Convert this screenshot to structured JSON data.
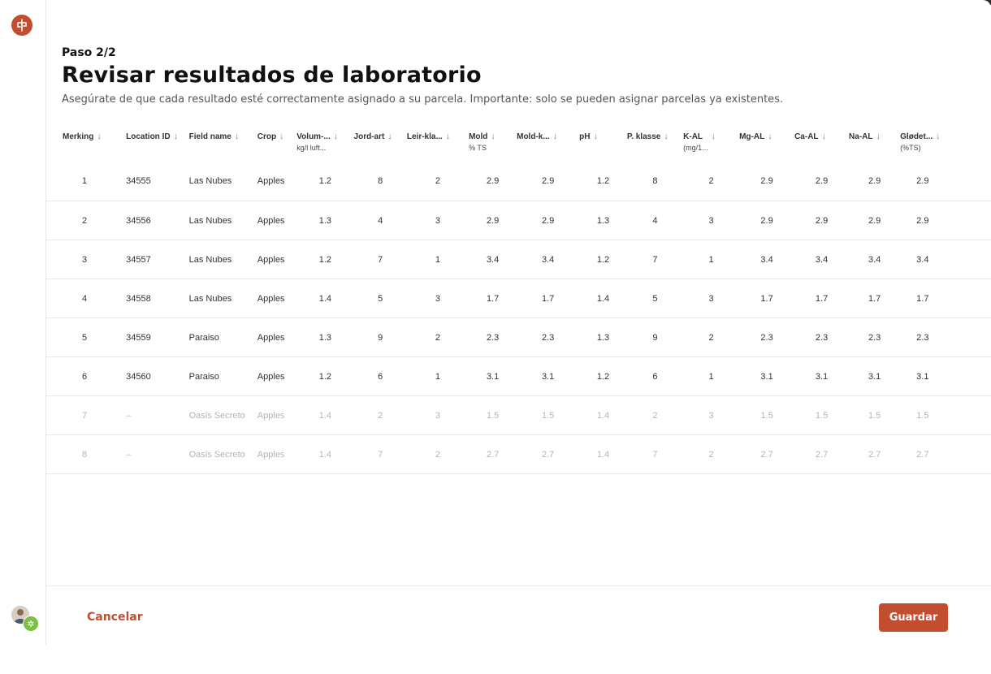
{
  "header": {
    "step": "Paso 2/2",
    "title": "Revisar resultados de laboratorio",
    "subtitle": "Asegúrate de que cada resultado esté correctamente asignado a su parcela. Importante: solo se pueden asignar parcelas ya existentes."
  },
  "columns": [
    {
      "label": "Merking",
      "sub": ""
    },
    {
      "label": "Location ID",
      "sub": ""
    },
    {
      "label": "Field name",
      "sub": ""
    },
    {
      "label": "Crop",
      "sub": ""
    },
    {
      "label": "Volum-...",
      "sub": "kg/l luft..."
    },
    {
      "label": "Jord-art",
      "sub": ""
    },
    {
      "label": "Leir-kla...",
      "sub": ""
    },
    {
      "label": "Mold",
      "sub": "% TS"
    },
    {
      "label": "Mold-k...",
      "sub": ""
    },
    {
      "label": "pH",
      "sub": ""
    },
    {
      "label": "P. klasse",
      "sub": ""
    },
    {
      "label": "K-AL",
      "sub": "(mg/1..."
    },
    {
      "label": "Mg-AL",
      "sub": ""
    },
    {
      "label": "Ca-AL",
      "sub": ""
    },
    {
      "label": "Na-AL",
      "sub": ""
    },
    {
      "label": "Glødet...",
      "sub": "(%TS)"
    }
  ],
  "rows": [
    [
      "1",
      "34555",
      "Las Nubes",
      "Apples",
      "1.2",
      "8",
      "2",
      "2.9",
      "2.9",
      "1.2",
      "8",
      "2",
      "2.9",
      "2.9",
      "2.9",
      "2.9"
    ],
    [
      "2",
      "34556",
      "Las Nubes",
      "Apples",
      "1.3",
      "4",
      "3",
      "2.9",
      "2.9",
      "1.3",
      "4",
      "3",
      "2.9",
      "2.9",
      "2.9",
      "2.9"
    ],
    [
      "3",
      "34557",
      "Las Nubes",
      "Apples",
      "1.2",
      "7",
      "1",
      "3.4",
      "3.4",
      "1.2",
      "7",
      "1",
      "3.4",
      "3.4",
      "3.4",
      "3.4"
    ],
    [
      "4",
      "34558",
      "Las Nubes",
      "Apples",
      "1.4",
      "5",
      "3",
      "1.7",
      "1.7",
      "1.4",
      "5",
      "3",
      "1.7",
      "1.7",
      "1.7",
      "1.7"
    ],
    [
      "5",
      "34559",
      "Paraiso",
      "Apples",
      "1.3",
      "9",
      "2",
      "2.3",
      "2.3",
      "1.3",
      "9",
      "2",
      "2.3",
      "2.3",
      "2.3",
      "2.3"
    ],
    [
      "6",
      "34560",
      "Paraiso",
      "Apples",
      "1.2",
      "6",
      "1",
      "3.1",
      "3.1",
      "1.2",
      "6",
      "1",
      "3.1",
      "3.1",
      "3.1",
      "3.1"
    ],
    [
      "7",
      "–",
      "Oasis Secreto",
      "Apples",
      "1.4",
      "2",
      "3",
      "1.5",
      "1.5",
      "1.4",
      "2",
      "3",
      "1.5",
      "1.5",
      "1.5",
      "1.5"
    ],
    [
      "8",
      "–",
      "Oasis Secreto",
      "Apples",
      "1.4",
      "7",
      "2",
      "2.7",
      "2.7",
      "1.4",
      "7",
      "2",
      "2.7",
      "2.7",
      "2.7",
      "2.7"
    ]
  ],
  "muted_rows": [
    7,
    8
  ],
  "footer": {
    "cancel_label": "Cancelar",
    "save_label": "Guardar"
  },
  "colors": {
    "accent": "#c24e2f",
    "badge": "#7bc043",
    "muted_text": "#b4b4b4"
  }
}
